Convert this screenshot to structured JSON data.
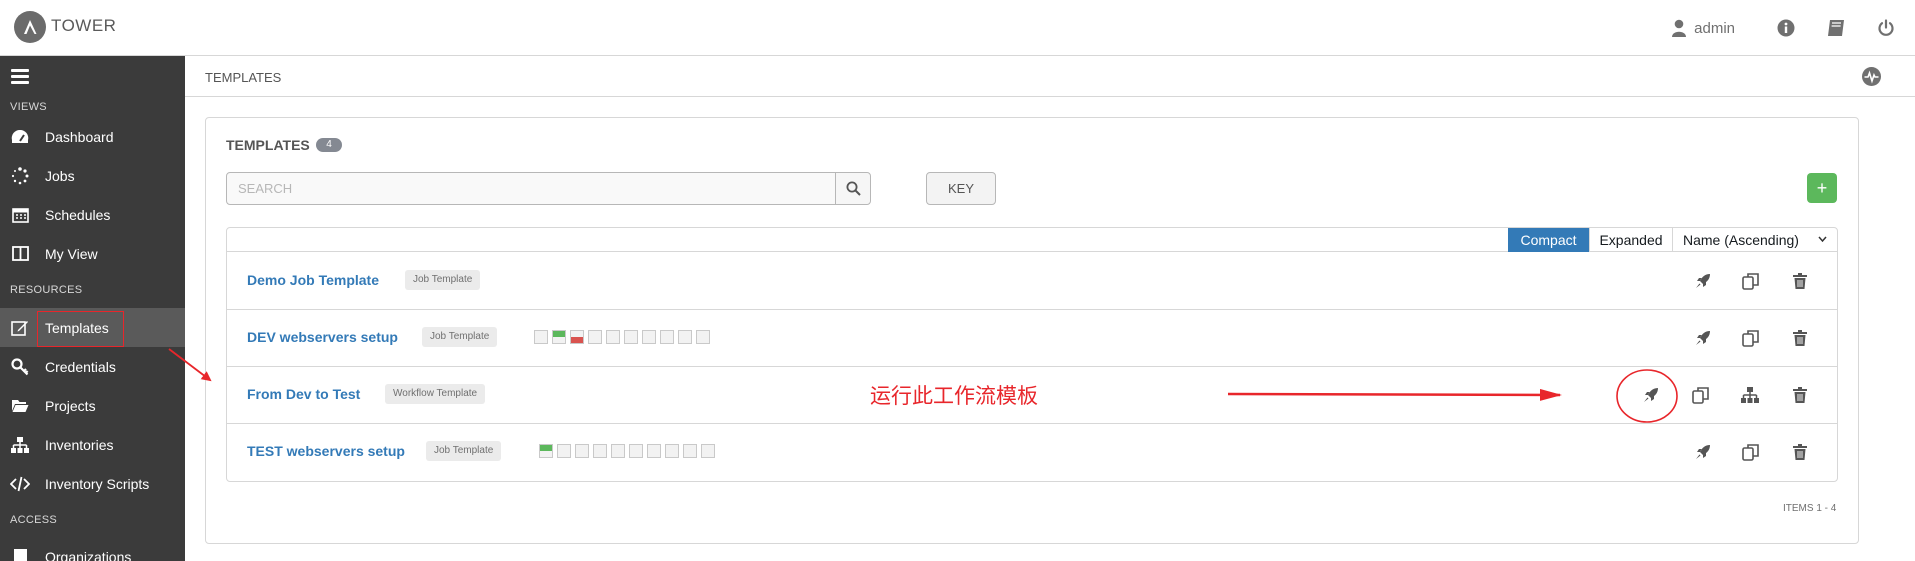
{
  "app": {
    "brand": "TOWER",
    "user": "admin"
  },
  "topbar": {
    "icons": [
      "user-icon",
      "info-icon",
      "book-icon",
      "power-icon"
    ]
  },
  "sidebar": {
    "sections": {
      "views": "VIEWS",
      "resources": "RESOURCES",
      "access": "ACCESS"
    },
    "items": [
      {
        "label": "Dashboard",
        "icon": "dashboard-icon"
      },
      {
        "label": "Jobs",
        "icon": "spinner-icon"
      },
      {
        "label": "Schedules",
        "icon": "calendar-icon"
      },
      {
        "label": "My View",
        "icon": "columns-icon"
      },
      {
        "label": "Templates",
        "icon": "edit-icon",
        "active": true
      },
      {
        "label": "Credentials",
        "icon": "key-icon"
      },
      {
        "label": "Projects",
        "icon": "folder-icon"
      },
      {
        "label": "Inventories",
        "icon": "sitemap-icon"
      },
      {
        "label": "Inventory Scripts",
        "icon": "code-icon"
      },
      {
        "label": "Organizations",
        "icon": "building-icon"
      }
    ]
  },
  "page": {
    "breadcrumb": "TEMPLATES",
    "panel_title": "TEMPLATES",
    "count": "4",
    "search_placeholder": "SEARCH",
    "key_label": "KEY",
    "add_label": "+",
    "view_compact": "Compact",
    "view_expanded": "Expanded",
    "sort_label": "Name (Ascending)",
    "items_label": "ITEMS  1 - 4"
  },
  "templates": [
    {
      "name": "Demo Job Template",
      "type": "Job Template",
      "jobs": []
    },
    {
      "name": "DEV webservers setup",
      "type": "Job Template",
      "jobs": [
        "none",
        "ok",
        "fail",
        "none",
        "none",
        "none",
        "none",
        "none",
        "none",
        "none"
      ]
    },
    {
      "name": "From Dev to Test",
      "type": "Workflow Template",
      "jobs": []
    },
    {
      "name": "TEST webservers setup",
      "type": "Job Template",
      "jobs": [
        "ok",
        "none",
        "none",
        "none",
        "none",
        "none",
        "none",
        "none",
        "none",
        "none"
      ]
    }
  ],
  "annotation": {
    "text": "运行此工作流模板",
    "color": "#e8262b"
  },
  "colors": {
    "sidebar_bg": "#3b3b3b",
    "link": "#337ab7",
    "success": "#5cb85c",
    "danger": "#d9534f",
    "annotation": "#e8262b"
  }
}
